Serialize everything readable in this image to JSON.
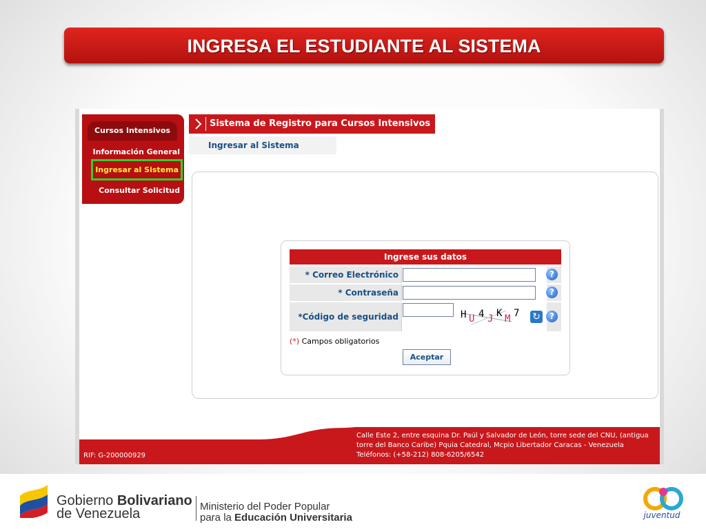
{
  "slide": {
    "title": "INGRESA EL ESTUDIANTE AL SISTEMA"
  },
  "sidebar": {
    "header": "Cursos Intensivos",
    "items": [
      {
        "label": "Información General"
      },
      {
        "label": "Ingresar al Sistema",
        "active": true
      },
      {
        "label": "Consultar Solicitud"
      }
    ]
  },
  "breadcrumb": {
    "title": "Sistema de Registro para Cursos Intensivos"
  },
  "subtitle": "Ingresar al Sistema",
  "form": {
    "header": "Ingrese sus datos",
    "email_label": "* Correo Electrónico",
    "email_value": "",
    "password_label": "* Contraseña",
    "password_value": "",
    "captcha_label": "*Código de seguridad",
    "captcha_value": "",
    "captcha_chars": [
      "H",
      "U",
      "4",
      "J",
      "K",
      "M",
      "7"
    ],
    "required_note_star": "(*)",
    "required_note_text": " Campos obligatorios",
    "submit_label": "Aceptar",
    "help_icon": "?"
  },
  "footer": {
    "address": "Calle Este 2, entre esquina Dr. Paúl y Salvador de León, torre sede del CNU, (antigua torre del Banco Caribe) Pquia Catedral, Mcpio Libertador Caracas - Venezuela Teléfonos: (+58-212) 808-6205/6542",
    "rif": "RIF: G-200000929"
  },
  "branding": {
    "gov_line1_a": "Gobierno ",
    "gov_line1_b": "Bolivariano",
    "gov_line2": "de Venezuela",
    "ministry_line1": "Ministerio del Poder Popular",
    "ministry_line2_a": "para la ",
    "ministry_line2_b": "Educación Universitaria",
    "bicentennial": "juventud"
  },
  "colors": {
    "primary_red": "#c9181c",
    "highlight_green": "#2ed12a",
    "link_blue": "#1a4f86"
  }
}
